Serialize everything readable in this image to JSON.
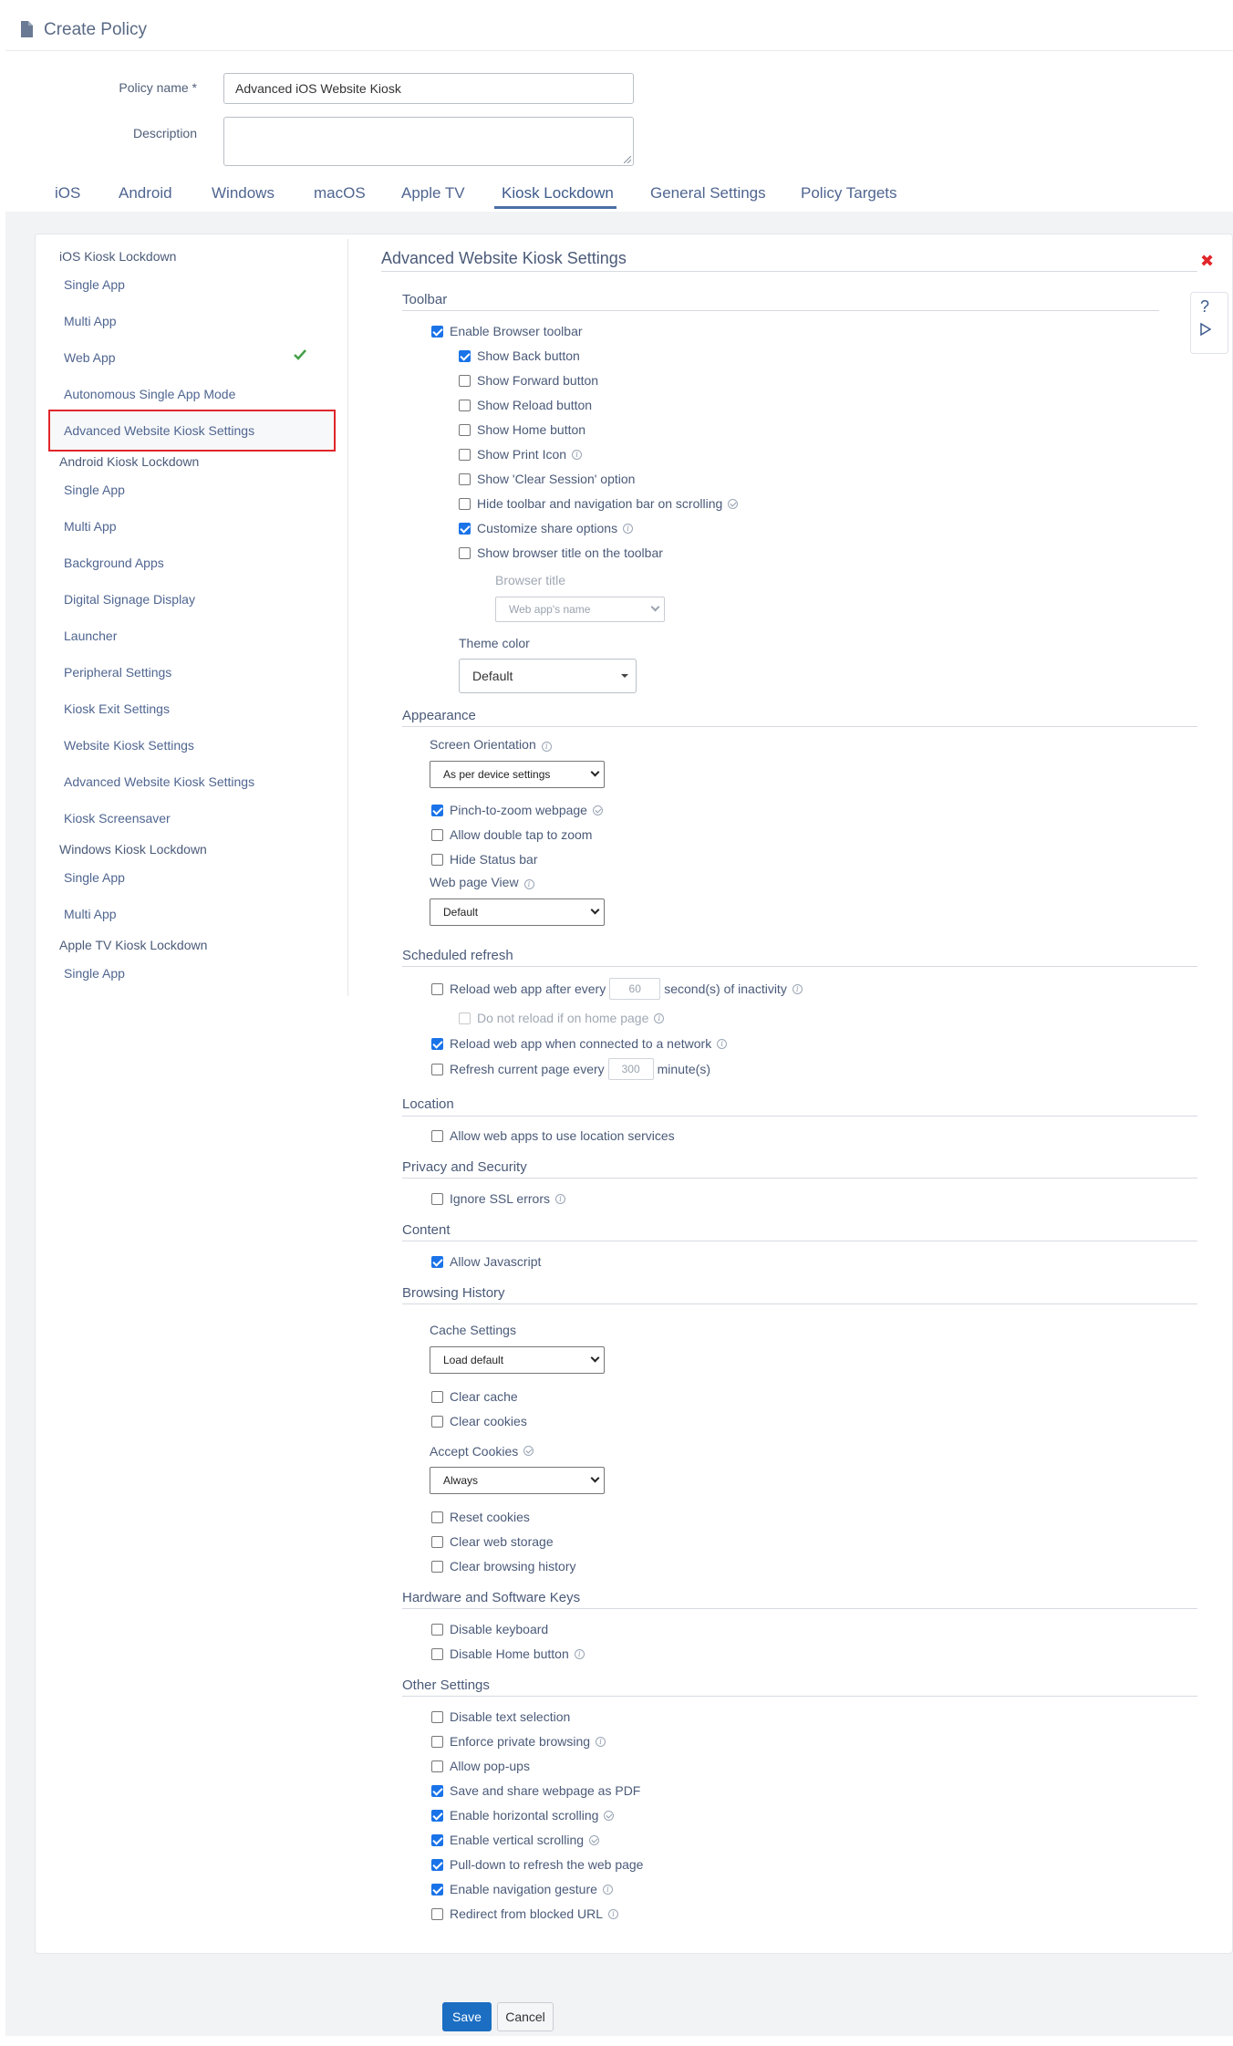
{
  "header": {
    "title": "Create Policy"
  },
  "form": {
    "policy_name_label": "Policy name *",
    "policy_name_value": "Advanced iOS Website Kiosk",
    "description_label": "Description",
    "description_value": ""
  },
  "tabs": [
    "iOS",
    "Android",
    "Windows",
    "macOS",
    "Apple TV",
    "Kiosk Lockdown",
    "General Settings",
    "Policy Targets"
  ],
  "sidebar": {
    "ios_group": "iOS Kiosk Lockdown",
    "ios_items": [
      "Single App",
      "Multi App",
      "Web App",
      "Autonomous Single App Mode",
      "Advanced Website Kiosk Settings"
    ],
    "android_group": "Android Kiosk Lockdown",
    "android_items": [
      "Single App",
      "Multi App",
      "Background Apps",
      "Digital Signage Display",
      "Launcher",
      "Peripheral Settings",
      "Kiosk Exit Settings",
      "Website Kiosk Settings",
      "Advanced Website Kiosk Settings",
      "Kiosk Screensaver"
    ],
    "windows_group": "Windows Kiosk Lockdown",
    "windows_items": [
      "Single App",
      "Multi App"
    ],
    "appletv_group": "Apple TV Kiosk Lockdown",
    "appletv_items": [
      "Single App"
    ]
  },
  "main": {
    "title": "Advanced Website Kiosk Settings",
    "help_label": "?",
    "toolbar": {
      "heading": "Toolbar",
      "items": [
        {
          "label": "Enable Browser toolbar",
          "checked": true
        },
        {
          "label": "Show Back button",
          "checked": true
        },
        {
          "label": "Show Forward button",
          "checked": false
        },
        {
          "label": "Show Reload button",
          "checked": false
        },
        {
          "label": "Show Home button",
          "checked": false
        },
        {
          "label": "Show Print Icon",
          "checked": false
        },
        {
          "label": "Show 'Clear Session' option",
          "checked": false
        },
        {
          "label": "Hide toolbar and navigation bar on scrolling",
          "checked": false
        },
        {
          "label": "Customize share options",
          "checked": true
        },
        {
          "label": "Show browser title on the toolbar",
          "checked": false
        }
      ],
      "browser_title_label": "Browser title",
      "browser_title_select": "Web app's name",
      "theme_color_label": "Theme color",
      "theme_color_select": "Default"
    },
    "appearance": {
      "heading": "Appearance",
      "orientation_label": "Screen Orientation",
      "orientation_select": "As per device settings",
      "items": [
        {
          "label": "Pinch-to-zoom webpage",
          "checked": true
        },
        {
          "label": "Allow double tap to zoom",
          "checked": false
        },
        {
          "label": "Hide Status bar",
          "checked": false
        }
      ],
      "webpage_view_label": "Web page View",
      "webpage_view_select": "Default"
    },
    "refresh": {
      "heading": "Scheduled refresh",
      "reload_prefix": "Reload web app after every",
      "reload_value": "60",
      "reload_suffix": "second(s) of inactivity",
      "no_reload_home": "Do not reload if on home page",
      "reload_network": "Reload web app when connected to a network",
      "refresh_prefix": "Refresh current page every",
      "refresh_value": "300",
      "refresh_suffix": "minute(s)"
    },
    "location": {
      "heading": "Location",
      "item": "Allow web apps to use location services"
    },
    "privacy": {
      "heading": "Privacy and Security",
      "item": "Ignore SSL errors"
    },
    "content": {
      "heading": "Content",
      "item": "Allow Javascript"
    },
    "history": {
      "heading": "Browsing History",
      "cache_label": "Cache Settings",
      "cache_select": "Load default",
      "clear_cache": "Clear cache",
      "clear_cookies": "Clear cookies",
      "accept_cookies_label": "Accept Cookies",
      "accept_cookies_select": "Always",
      "reset_cookies": "Reset cookies",
      "clear_web_storage": "Clear web storage",
      "clear_browsing_history": "Clear browsing history"
    },
    "keys": {
      "heading": "Hardware and Software Keys",
      "disable_keyboard": "Disable keyboard",
      "disable_home": "Disable Home button"
    },
    "other": {
      "heading": "Other Settings",
      "items": [
        {
          "label": "Disable text selection",
          "checked": false
        },
        {
          "label": "Enforce private browsing",
          "checked": false
        },
        {
          "label": "Allow pop-ups",
          "checked": false
        },
        {
          "label": "Save and share webpage as PDF",
          "checked": true
        },
        {
          "label": "Enable horizontal scrolling",
          "checked": true
        },
        {
          "label": "Enable vertical scrolling",
          "checked": true
        },
        {
          "label": "Pull-down to refresh the web page",
          "checked": true
        },
        {
          "label": "Enable navigation gesture",
          "checked": true
        },
        {
          "label": "Redirect from blocked URL",
          "checked": false
        }
      ]
    }
  },
  "buttons": {
    "save": "Save",
    "cancel": "Cancel"
  },
  "colors": {
    "accent": "#1b6ec2",
    "highlight_border": "#e0262b",
    "check_green": "#43a047"
  }
}
